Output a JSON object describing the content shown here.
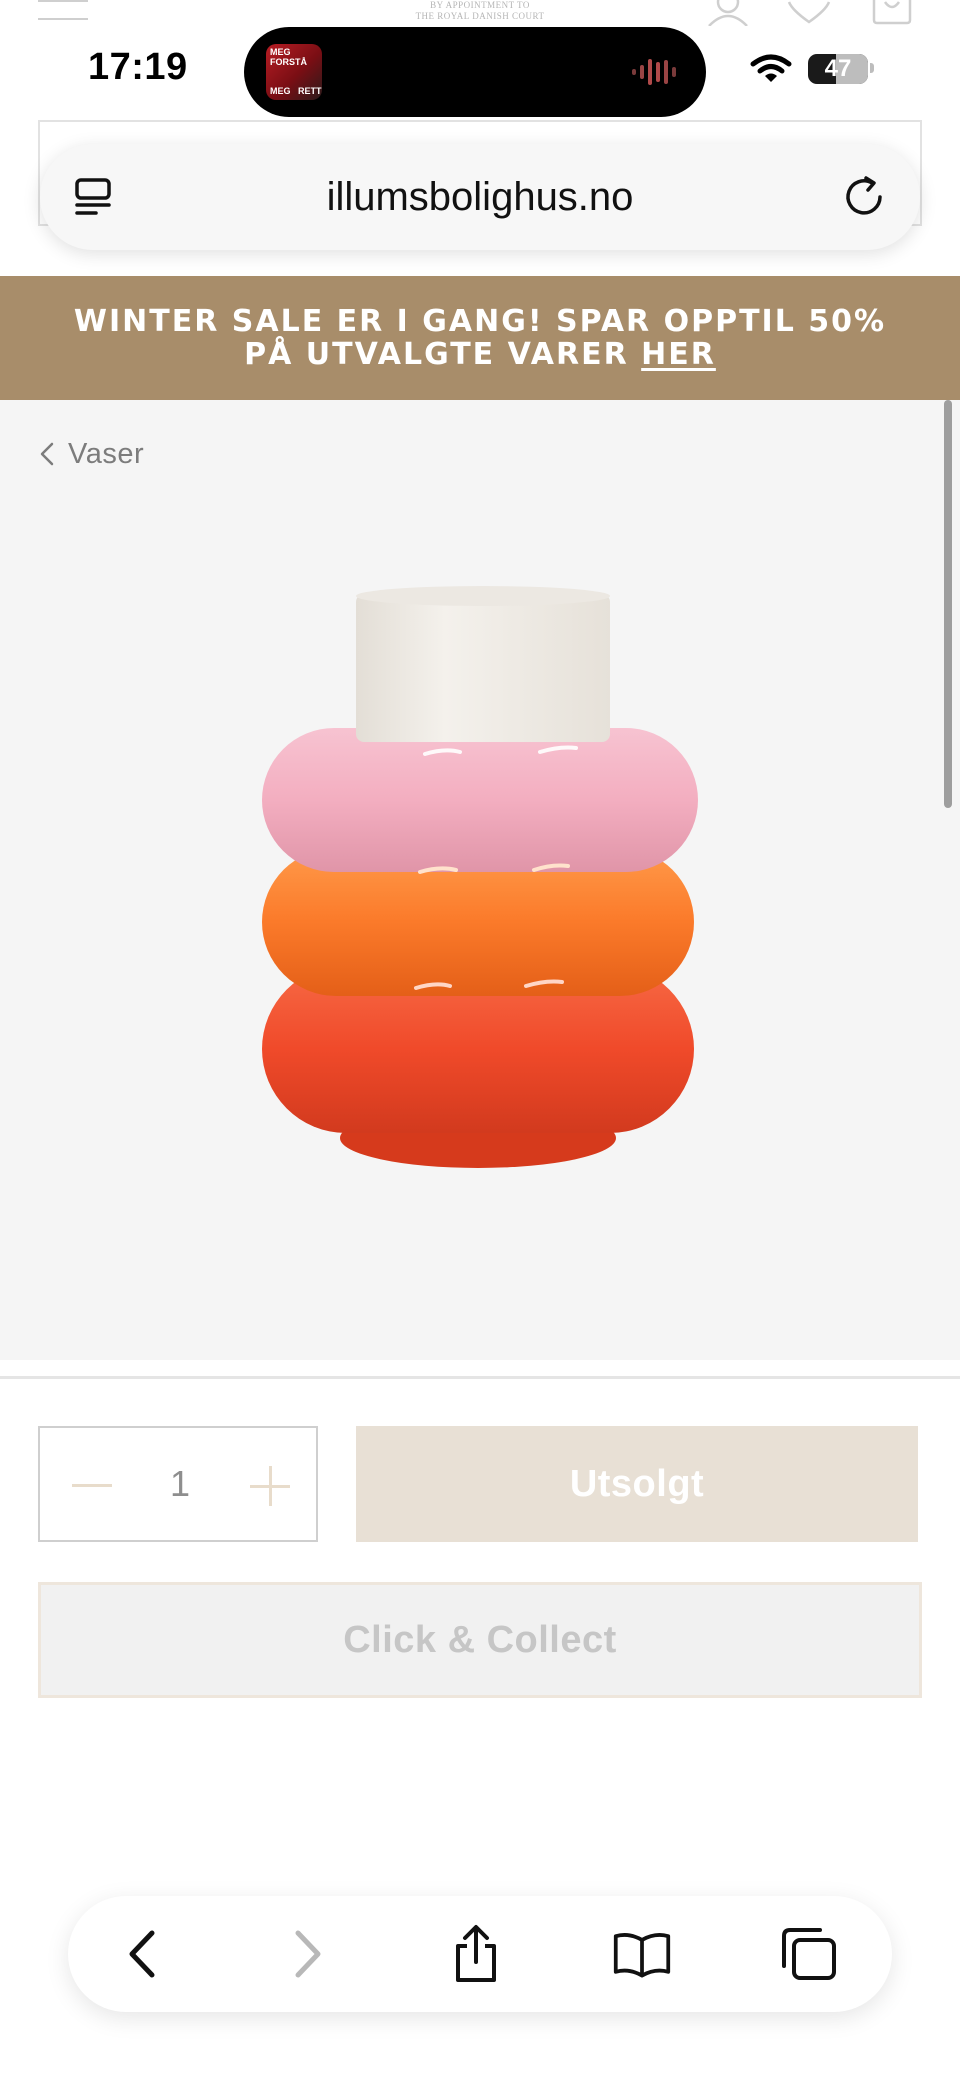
{
  "status_bar": {
    "time": "17:19",
    "battery": "47",
    "now_playing_art_text": [
      "MEG FORSTÅ",
      "MEG",
      "RETT"
    ]
  },
  "site_header": {
    "royal_text_line1": "BY APPOINTMENT TO",
    "royal_text_line2": "THE ROYAL DANISH COURT"
  },
  "browser": {
    "url": "illumsbolighus.no"
  },
  "promo": {
    "line1": "WINTER SALE ER I GANG! SPAR OPPTIL 50%",
    "line2_prefix": "PÅ UTVALGTE VARER ",
    "link_text": "HER",
    "background": "#a88d6a"
  },
  "breadcrumb": {
    "label": "Vaser"
  },
  "product": {
    "quantity": "1",
    "soldout_label": "Utsolgt",
    "click_collect_label": "Click & Collect",
    "vase_colors": [
      "#f2efe9",
      "#f3b3c4",
      "#fb7a2a",
      "#f04a2a"
    ]
  },
  "toolbar": {
    "icons": [
      "back-icon",
      "forward-icon",
      "share-icon",
      "bookmarks-icon",
      "tabs-icon"
    ]
  }
}
